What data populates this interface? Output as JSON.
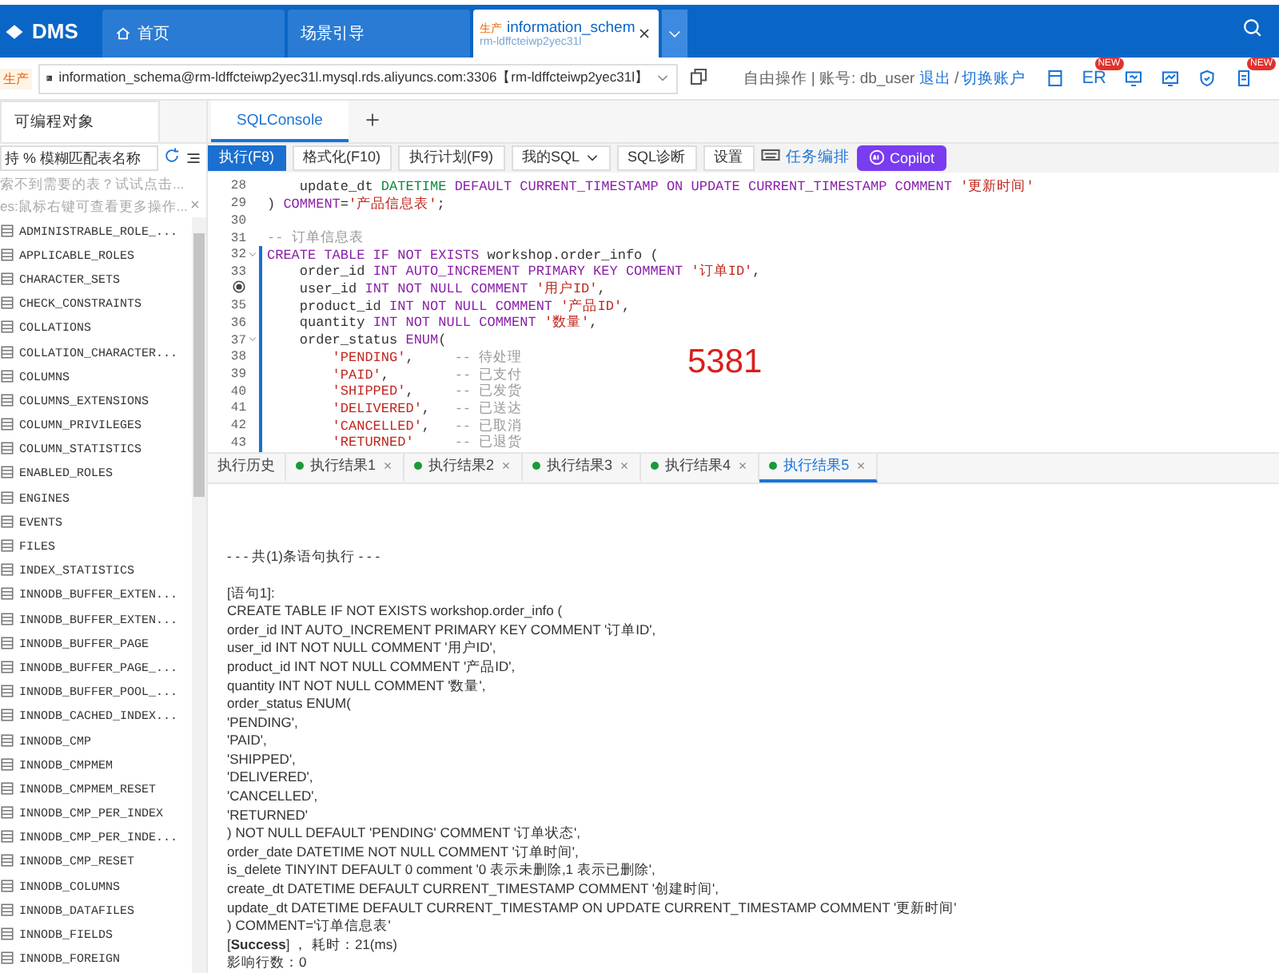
{
  "topbar": {
    "logo": "DMS",
    "tabs": [
      {
        "label": "首页",
        "kind": "home",
        "selected": false
      },
      {
        "label": "场景引导",
        "kind": "plain",
        "selected": false
      },
      {
        "label": "information_schem",
        "kind": "instance",
        "tag": "生产",
        "sublabel": "rm-ldffcteiwp2yec31l",
        "selected": true
      }
    ]
  },
  "connection": {
    "tag": "生产",
    "text": "information_schema@rm-ldffcteiwp2yec31l.mysql.rds.aliyuncs.com:3306【rm-ldffcteiwp2yec31l】",
    "mode": "自由操作 | 账号: db_user",
    "logout": "退出",
    "separator": "/",
    "switch": "切换账户",
    "tools": [
      {
        "kind": "calculator"
      },
      {
        "kind": "text",
        "label": "ER",
        "badge": "NEW"
      },
      {
        "kind": "monitor"
      },
      {
        "kind": "chart"
      },
      {
        "kind": "shield"
      },
      {
        "kind": "document",
        "badge": "NEW"
      }
    ]
  },
  "sidebar": {
    "tab": "可编程对象",
    "search": {
      "placeholder": "持 % 模糊匹配表名称"
    },
    "hints": [
      "索不到需要的表？试试点击...",
      "es:鼠标右键可查看更多操作..."
    ],
    "items": [
      "ADMINISTRABLE_ROLE_...",
      "APPLICABLE_ROLES",
      "CHARACTER_SETS",
      "CHECK_CONSTRAINTS",
      "COLLATIONS",
      "COLLATION_CHARACTER...",
      "COLUMNS",
      "COLUMNS_EXTENSIONS",
      "COLUMN_PRIVILEGES",
      "COLUMN_STATISTICS",
      "ENABLED_ROLES",
      "ENGINES",
      "EVENTS",
      "FILES",
      "INDEX_STATISTICS",
      "INNODB_BUFFER_EXTEN...",
      "INNODB_BUFFER_EXTEN...",
      "INNODB_BUFFER_PAGE",
      "INNODB_BUFFER_PAGE_...",
      "INNODB_BUFFER_POOL_...",
      "INNODB_CACHED_INDEX...",
      "INNODB_CMP",
      "INNODB_CMPMEM",
      "INNODB_CMPMEM_RESET",
      "INNODB_CMP_PER_INDEX",
      "INNODB_CMP_PER_INDE...",
      "INNODB_CMP_RESET",
      "INNODB_COLUMNS",
      "INNODB_DATAFILES",
      "INNODB_FIELDS",
      "INNODB_FOREIGN"
    ]
  },
  "console_tabs": [
    {
      "label": "SQLConsole",
      "selected": true
    }
  ],
  "toolbar": [
    {
      "kind": "primary",
      "label": "执行(F8)"
    },
    {
      "kind": "button",
      "label": "格式化(F10)"
    },
    {
      "kind": "button",
      "label": "执行计划(F9)"
    },
    {
      "kind": "dropdown",
      "label": "我的SQL"
    },
    {
      "kind": "button",
      "label": "SQL诊断"
    },
    {
      "kind": "button",
      "label": "设置"
    },
    {
      "kind": "keyboard"
    },
    {
      "kind": "link",
      "label": "任务编排"
    },
    {
      "kind": "copilot",
      "label": "Copilot"
    }
  ],
  "editor": {
    "overlay_number": "5381",
    "lines": [
      {
        "number": "28",
        "fold": false,
        "current": false,
        "in_statement": false,
        "segments": [
          {
            "kind": "plain",
            "text": "    update_dt "
          },
          {
            "kind": "type",
            "text": "DATETIME"
          },
          {
            "kind": "keyword",
            "text": " DEFAULT CURRENT_TIMESTAMP ON UPDATE CURRENT_TIMESTAMP COMMENT "
          },
          {
            "kind": "string",
            "text": "'更新时间'"
          }
        ]
      },
      {
        "number": "29",
        "fold": false,
        "current": false,
        "in_statement": false,
        "segments": [
          {
            "kind": "plain",
            "text": ") "
          },
          {
            "kind": "keyword",
            "text": "COMMENT"
          },
          {
            "kind": "plain",
            "text": "="
          },
          {
            "kind": "string",
            "text": "'产品信息表'"
          },
          {
            "kind": "plain",
            "text": ";"
          }
        ]
      },
      {
        "number": "30",
        "fold": false,
        "current": false,
        "in_statement": false
      },
      {
        "number": "31",
        "fold": false,
        "current": false,
        "in_statement": false,
        "segments": [
          {
            "kind": "comment",
            "text": "-- 订单信息表"
          }
        ]
      },
      {
        "number": "32",
        "fold": true,
        "current": false,
        "in_statement": true,
        "segments": [
          {
            "kind": "keyword",
            "text": "CREATE TABLE IF NOT EXISTS"
          },
          {
            "kind": "plain",
            "text": " workshop.order_info ("
          }
        ]
      },
      {
        "number": "33",
        "fold": false,
        "current": false,
        "in_statement": true,
        "segments": [
          {
            "kind": "plain",
            "text": "    order_id "
          },
          {
            "kind": "keyword",
            "text": "INT AUTO_INCREMENT PRIMARY KEY COMMENT "
          },
          {
            "kind": "string",
            "text": "'订单ID'"
          },
          {
            "kind": "plain",
            "text": ","
          }
        ]
      },
      {
        "fold": false,
        "current": true,
        "in_statement": true,
        "segments": [
          {
            "kind": "plain",
            "text": "    user_id "
          },
          {
            "kind": "keyword",
            "text": "INT NOT NULL COMMENT "
          },
          {
            "kind": "string",
            "text": "'用户ID'"
          },
          {
            "kind": "plain",
            "text": ","
          }
        ]
      },
      {
        "number": "35",
        "fold": false,
        "current": false,
        "in_statement": true,
        "segments": [
          {
            "kind": "plain",
            "text": "    product_id "
          },
          {
            "kind": "keyword",
            "text": "INT NOT NULL COMMENT "
          },
          {
            "kind": "string",
            "text": "'产品ID'"
          },
          {
            "kind": "plain",
            "text": ","
          }
        ]
      },
      {
        "number": "36",
        "fold": false,
        "current": false,
        "in_statement": true,
        "segments": [
          {
            "kind": "plain",
            "text": "    quantity "
          },
          {
            "kind": "keyword",
            "text": "INT NOT NULL COMMENT "
          },
          {
            "kind": "string",
            "text": "'数量'"
          },
          {
            "kind": "plain",
            "text": ","
          }
        ]
      },
      {
        "number": "37",
        "fold": true,
        "current": false,
        "in_statement": true,
        "segments": [
          {
            "kind": "plain",
            "text": "    order_status "
          },
          {
            "kind": "keyword",
            "text": "ENUM"
          },
          {
            "kind": "plain",
            "text": "("
          }
        ]
      },
      {
        "number": "38",
        "fold": false,
        "current": false,
        "in_statement": true,
        "segments": [
          {
            "kind": "string",
            "text": "        'PENDING'"
          },
          {
            "kind": "plain",
            "text": ",     "
          },
          {
            "kind": "comment",
            "text": "-- 待处理"
          }
        ]
      },
      {
        "number": "39",
        "fold": false,
        "current": false,
        "in_statement": true,
        "segments": [
          {
            "kind": "string",
            "text": "        'PAID'"
          },
          {
            "kind": "plain",
            "text": ",        "
          },
          {
            "kind": "comment",
            "text": "-- 已支付"
          }
        ]
      },
      {
        "number": "40",
        "fold": false,
        "current": false,
        "in_statement": true,
        "segments": [
          {
            "kind": "string",
            "text": "        'SHIPPED'"
          },
          {
            "kind": "plain",
            "text": ",     "
          },
          {
            "kind": "comment",
            "text": "-- 已发货"
          }
        ]
      },
      {
        "number": "41",
        "fold": false,
        "current": false,
        "in_statement": true,
        "segments": [
          {
            "kind": "string",
            "text": "        'DELIVERED'"
          },
          {
            "kind": "plain",
            "text": ",   "
          },
          {
            "kind": "comment",
            "text": "-- 已送达"
          }
        ]
      },
      {
        "number": "42",
        "fold": false,
        "current": false,
        "in_statement": true,
        "segments": [
          {
            "kind": "string",
            "text": "        'CANCELLED'"
          },
          {
            "kind": "plain",
            "text": ",   "
          },
          {
            "kind": "comment",
            "text": "-- 已取消"
          }
        ]
      },
      {
        "number": "43",
        "fold": false,
        "current": false,
        "in_statement": true,
        "segments": [
          {
            "kind": "string",
            "text": "        'RETURNED'"
          },
          {
            "kind": "comment",
            "text": "     -- 已退货"
          }
        ]
      }
    ]
  },
  "result_tabs": [
    {
      "label": "执行历史",
      "kind": "history",
      "selected": false
    },
    {
      "label": "执行结果1",
      "kind": "result",
      "selected": false
    },
    {
      "label": "执行结果2",
      "kind": "result",
      "selected": false
    },
    {
      "label": "执行结果3",
      "kind": "result",
      "selected": false
    },
    {
      "label": "执行结果4",
      "kind": "result",
      "selected": false
    },
    {
      "label": "执行结果5",
      "kind": "result",
      "selected": true
    }
  ],
  "output": {
    "header": "- - - 共(1)条语句执行 - - -",
    "lines": [
      {
        "kind": "text",
        "text": "[语句1]:"
      },
      {
        "kind": "text",
        "text": "CREATE TABLE IF NOT EXISTS workshop.order_info ("
      },
      {
        "kind": "text",
        "text": "order_id INT AUTO_INCREMENT PRIMARY KEY COMMENT '订单ID',"
      },
      {
        "kind": "text",
        "text": "user_id INT NOT NULL COMMENT '用户ID',"
      },
      {
        "kind": "text",
        "text": "product_id INT NOT NULL COMMENT '产品ID',"
      },
      {
        "kind": "text",
        "text": "quantity INT NOT NULL COMMENT '数量',"
      },
      {
        "kind": "text",
        "text": "order_status ENUM("
      },
      {
        "kind": "text",
        "text": "'PENDING',"
      },
      {
        "kind": "text",
        "text": "'PAID',"
      },
      {
        "kind": "text",
        "text": "'SHIPPED',"
      },
      {
        "kind": "text",
        "text": "'DELIVERED',"
      },
      {
        "kind": "text",
        "text": "'CANCELLED',"
      },
      {
        "kind": "text",
        "text": "'RETURNED'"
      },
      {
        "kind": "text",
        "text": ") NOT NULL DEFAULT 'PENDING' COMMENT '订单状态',"
      },
      {
        "kind": "text",
        "text": "order_date DATETIME NOT NULL COMMENT '订单时间',"
      },
      {
        "kind": "text",
        "text": "is_delete TINYINT DEFAULT 0 comment '0 表示未删除,1 表示已删除',"
      },
      {
        "kind": "text",
        "text": "create_dt DATETIME DEFAULT CURRENT_TIMESTAMP COMMENT '创建时间',"
      },
      {
        "kind": "text",
        "text": "update_dt DATETIME DEFAULT CURRENT_TIMESTAMP ON UPDATE CURRENT_TIMESTAMP COMMENT '更新时间'"
      },
      {
        "kind": "text",
        "text": ") COMMENT='订单信息表'"
      },
      {
        "kind": "status",
        "text": "[**Success**] ， 耗时：21(ms)"
      },
      {
        "kind": "text",
        "text": "影响行数：0"
      }
    ]
  }
}
